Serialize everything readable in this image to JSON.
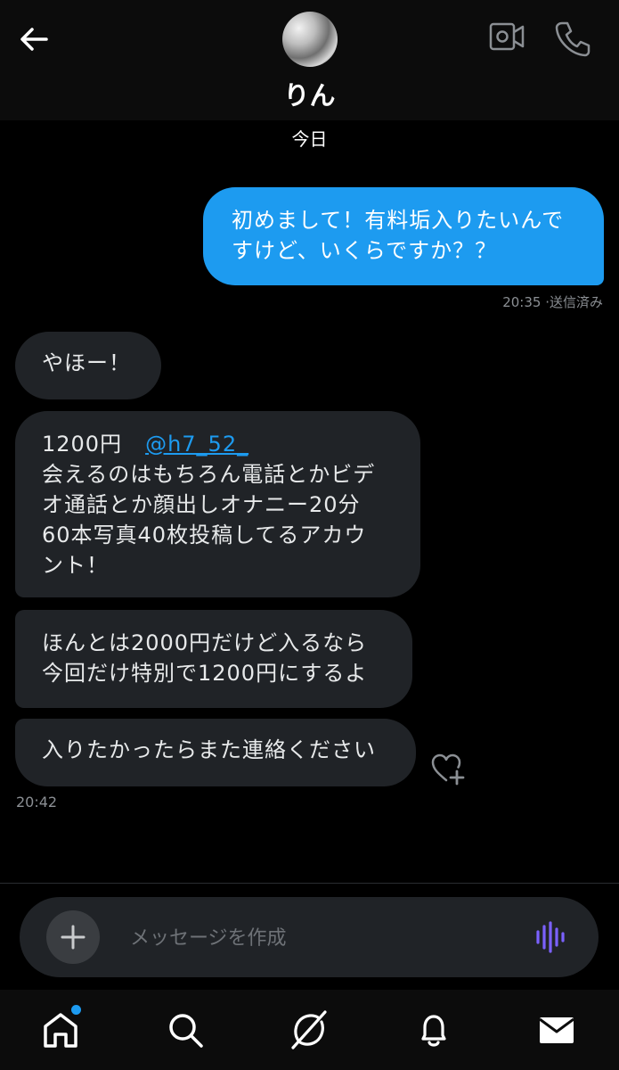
{
  "header": {
    "contact_name": "りん"
  },
  "day_label": "今日",
  "sent_message": {
    "line1": "初めまして！有料垢入りたいんで",
    "line2": "すけど、いくらですか？？",
    "time": "20:35",
    "status": "·送信済み"
  },
  "received_messages": {
    "m1": "やほー！",
    "m2_price": "1200円",
    "m2_mention": "@h7_52_",
    "m2_line2": "会えるのはもちろん電話とかビデ",
    "m2_line3": "オ通話とか顔出しオナニー20分",
    "m2_line4": "60本写真40枚投稿してるアカウ",
    "m2_line5": "ント！",
    "m3_line1": "ほんとは2000円だけど入るなら",
    "m3_line2": "今回だけ特別で1200円にするよ",
    "m4": "入りたかったらまた連絡ください",
    "time": "20:42"
  },
  "composer": {
    "placeholder": "メッセージを作成"
  },
  "icons": {
    "back": "arrow-left-icon",
    "video": "video-camera-icon",
    "phone": "phone-icon",
    "react": "heart-plus-icon",
    "add": "plus-icon",
    "voice": "waveform-icon",
    "home": "home-icon",
    "search": "search-icon",
    "grok": "grok-icon",
    "notifications": "bell-icon",
    "messages": "envelope-icon"
  },
  "colors": {
    "accent": "#1d9bf0",
    "sent_bubble": "#1d9bf0",
    "received_bubble": "#202327",
    "background": "#000000",
    "voice_icon": "#7b61ff"
  }
}
